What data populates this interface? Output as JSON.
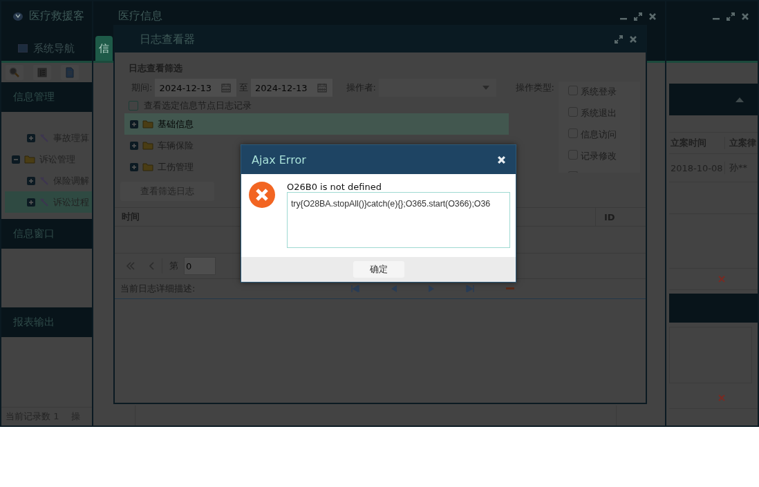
{
  "main_window": {
    "title": "医疗救援客",
    "tabs": [
      {
        "label": "系统导航",
        "selected": false
      }
    ],
    "sidebar": {
      "info_panel": {
        "title": "信息管理",
        "scrolled_items": [
          {
            "label": "事故理算",
            "expanded": false,
            "selected": false
          }
        ],
        "tree": [
          {
            "label": "诉讼管理",
            "expanded": true,
            "selected": false,
            "children": [
              {
                "label": "保险调解",
                "expanded": false,
                "selected": false
              },
              {
                "label": "诉讼过程",
                "expanded": false,
                "selected": true
              }
            ]
          }
        ]
      },
      "window_panel": {
        "title": "信息窗口"
      },
      "report_panel": {
        "title": "报表输出"
      }
    },
    "right_panel": {
      "table": {
        "columns": [
          "立案时间",
          "立案律"
        ],
        "rows": [
          [
            "2018-10-08",
            "孙**"
          ]
        ]
      }
    },
    "status_bar": {
      "record_count": "当前记录数 1",
      "operation": "操"
    }
  },
  "medical_window": {
    "title": "医疗信息",
    "tabs": [
      {
        "label": "信",
        "selected": true
      }
    ]
  },
  "log_viewer": {
    "title": "日志查看器",
    "filter": {
      "title": "日志查看筛选",
      "period_label": "期间:",
      "date_from": "2024-12-13",
      "to_label": "至",
      "date_to": "2024-12-13",
      "operator_label": "操作者:",
      "operation_type_label": "操作类型:",
      "operation_types": [
        {
          "label": "系统登录",
          "checked": false
        },
        {
          "label": "系统退出",
          "checked": false
        },
        {
          "label": "信息访问",
          "checked": false
        },
        {
          "label": "记录修改",
          "checked": false
        }
      ],
      "node_filter": {
        "label": "查看选定信息节点日志记录",
        "checked": false
      },
      "tree": [
        {
          "label": "基础信息",
          "expanded": false,
          "selected": true
        },
        {
          "label": "车辆保险",
          "expanded": false,
          "selected": false
        },
        {
          "label": "工伤管理",
          "expanded": false,
          "selected": false
        }
      ]
    },
    "filter_button": "查看筛选日志",
    "grid": {
      "columns": [
        "时间",
        "ID"
      ]
    },
    "pager": {
      "page_label": "第",
      "page": "0"
    },
    "detail_label": "当前日志详细描述:"
  },
  "dialog": {
    "title": "Ajax Error",
    "message": "O26B0 is not defined",
    "detail": "try{O28BA.stopAll()}catch(e){};O365.start(O366);O36",
    "button": "确定"
  }
}
